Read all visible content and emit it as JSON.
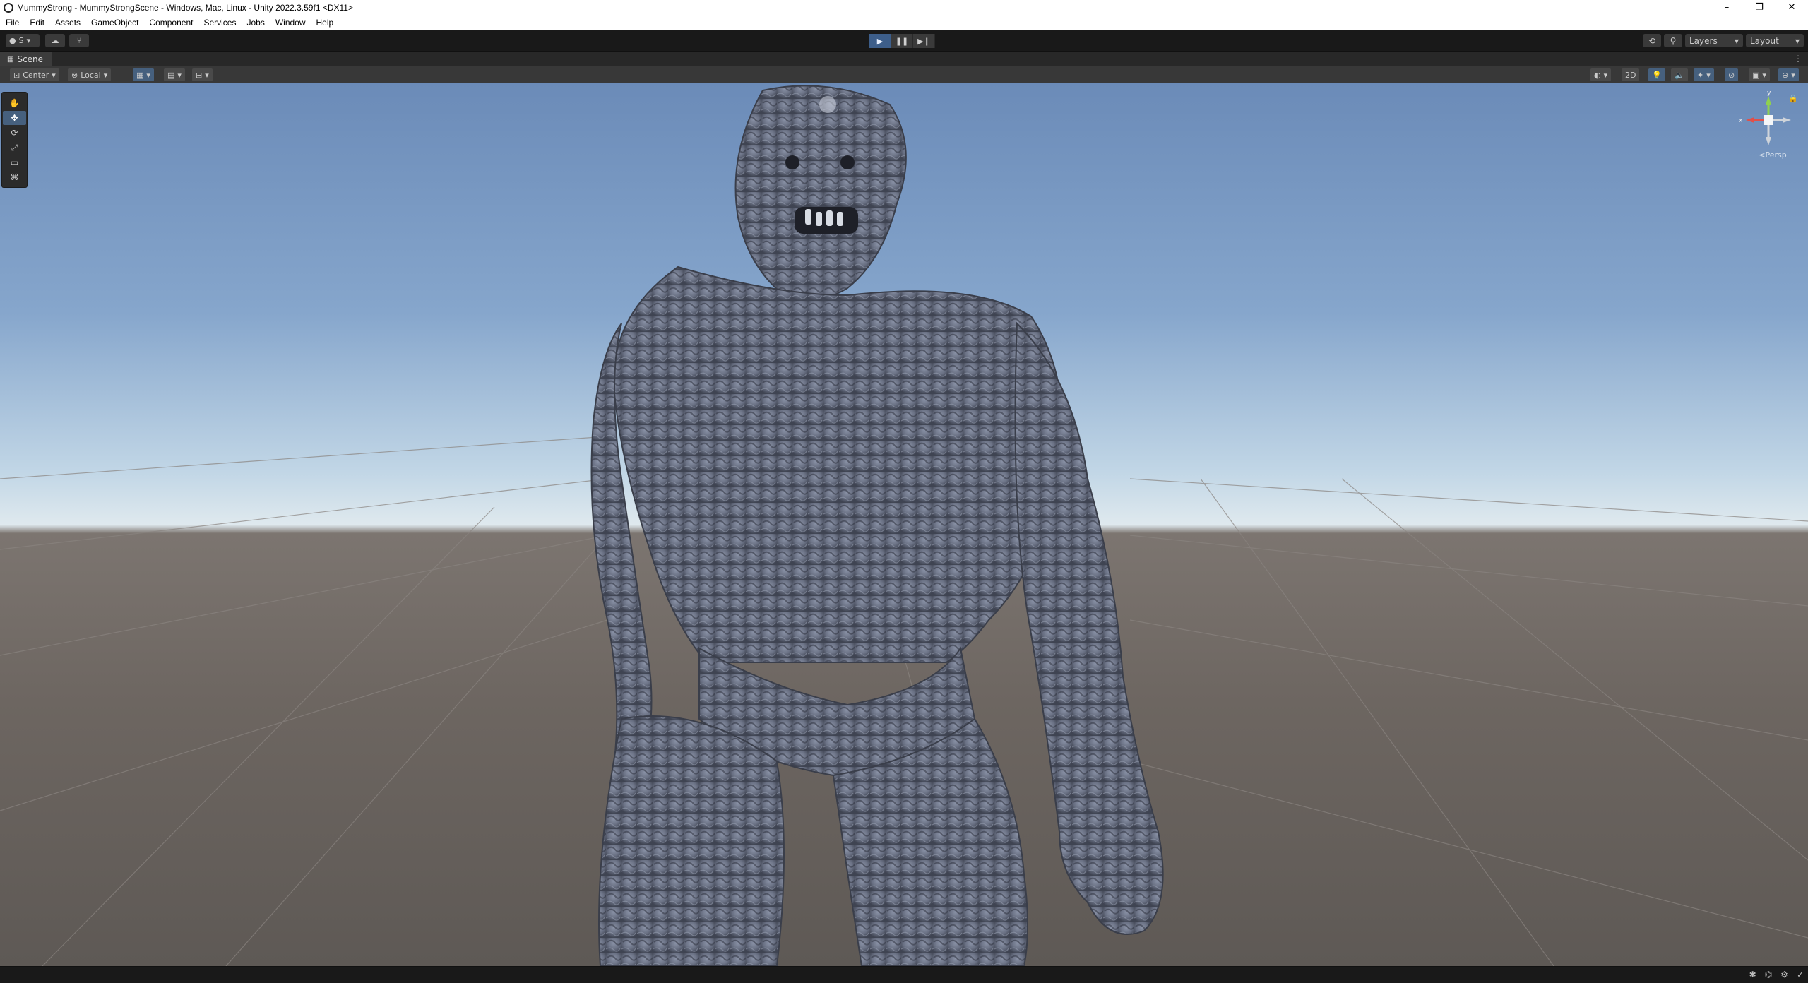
{
  "window": {
    "title": "MummyStrong - MummyStrongScene - Windows, Mac, Linux - Unity 2022.3.59f1 <DX11>",
    "controls": {
      "minimize": "–",
      "maximize": "❐",
      "close": "✕"
    }
  },
  "menubar": {
    "items": [
      "File",
      "Edit",
      "Assets",
      "GameObject",
      "Component",
      "Services",
      "Jobs",
      "Window",
      "Help"
    ]
  },
  "main_toolbar": {
    "account_label": "S",
    "play_buttons": {
      "play": "▶",
      "pause": "❚❚",
      "step": "▶❙"
    },
    "play_state": "playing",
    "layers_label": "Layers",
    "layout_label": "Layout"
  },
  "scene_tab": {
    "label": "Scene"
  },
  "scene_toolbar": {
    "pivot_label": "Center",
    "space_label": "Local",
    "mode_2d": "2D"
  },
  "tools": {
    "items": [
      {
        "name": "view-tool",
        "icon": "✋",
        "active": false
      },
      {
        "name": "move-tool",
        "icon": "✥",
        "active": true
      },
      {
        "name": "rotate-tool",
        "icon": "⟳",
        "active": false
      },
      {
        "name": "scale-tool",
        "icon": "⤢",
        "active": false
      },
      {
        "name": "rect-tool",
        "icon": "▭",
        "active": false
      },
      {
        "name": "transform-tool",
        "icon": "⌘",
        "active": false
      }
    ]
  },
  "gizmo": {
    "projection_label": "<Persp",
    "axis_x": "x",
    "axis_y": "y"
  },
  "colors": {
    "active_blue": "#46607e",
    "play_active": "#3d5e8a",
    "sky_top": "#6b8bb8",
    "ground": "#6d6661",
    "creature": "#6a7080"
  }
}
